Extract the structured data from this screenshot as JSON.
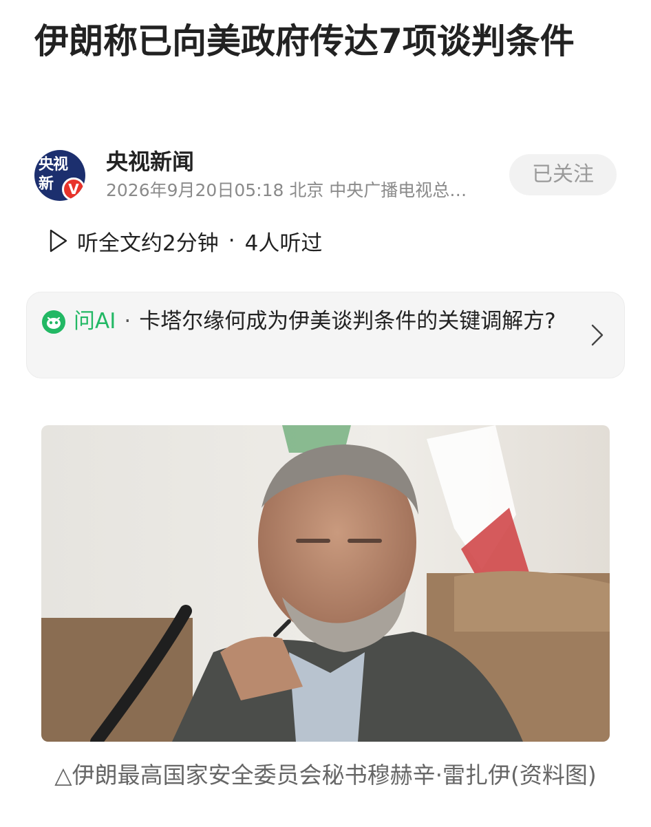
{
  "article": {
    "title": "伊朗称已向美政府传达7项谈判条件"
  },
  "author": {
    "avatar_text": "央视新",
    "verified_badge": "V",
    "name": "央视新闻",
    "meta": "2026年9月20日05:18 北京 中央广播电视总…",
    "follow_label": "已关注"
  },
  "listen": {
    "play_icon": "play-icon",
    "label": "听全文约2分钟",
    "separator": "·",
    "listeners": "4人听过"
  },
  "ask_ai": {
    "label": "问AI",
    "separator": "·",
    "question": "卡塔尔缘何成为伊美谈判条件的关键调解方?",
    "icon": "ai-assistant-icon",
    "chevron": "chevron-right-icon"
  },
  "image": {
    "caption": "△伊朗最高国家安全委员会秘书穆赫辛·雷扎伊(资料图)"
  },
  "colors": {
    "accent_green": "#22b864",
    "verified_red": "#e8332a",
    "avatar_navy": "#1c2f6e",
    "meta_gray": "#8a8a8a"
  }
}
